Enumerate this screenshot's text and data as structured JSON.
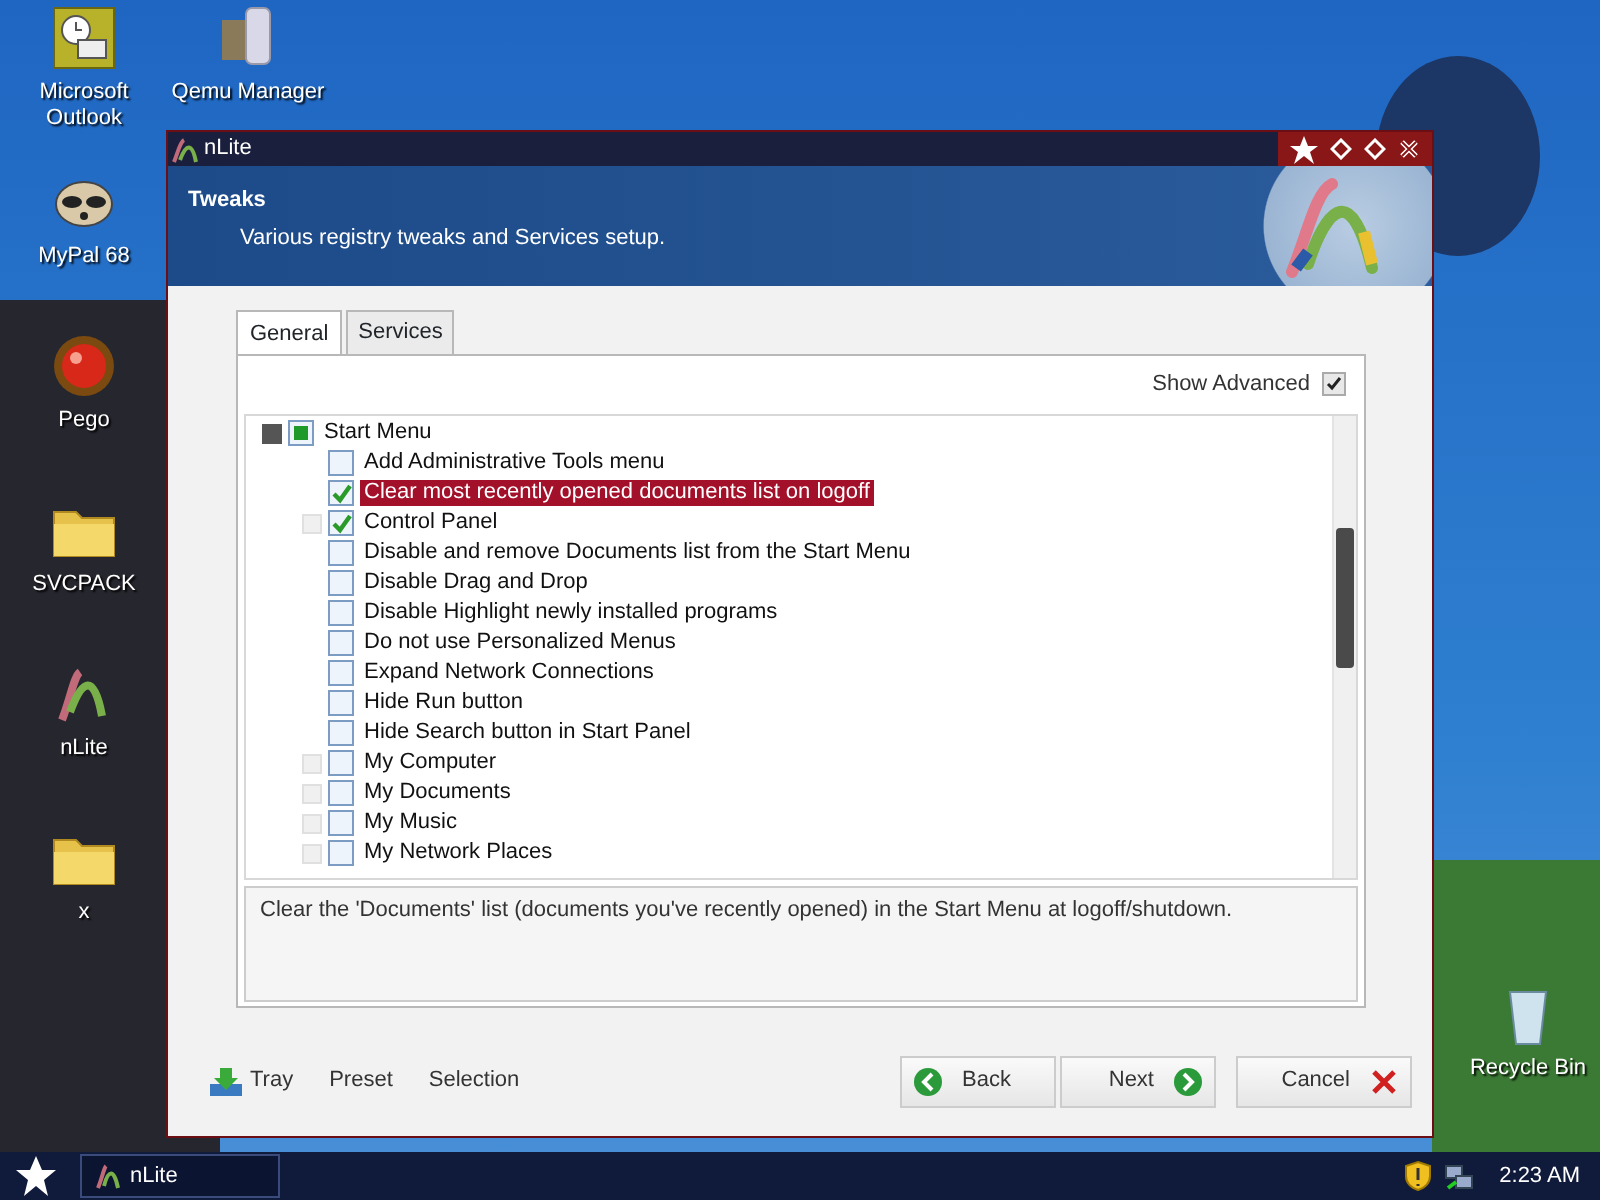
{
  "desktop": {
    "columns": [
      [
        {
          "label": "Microsoft Outlook",
          "kind": "outlook"
        },
        {
          "label": "MyPal 68",
          "kind": "raccoon"
        },
        {
          "label": "Pego",
          "kind": "orb"
        },
        {
          "label": "SVCPACK",
          "kind": "folder"
        },
        {
          "label": "nLite",
          "kind": "nlite"
        },
        {
          "label": "x",
          "kind": "folder"
        }
      ],
      [
        {
          "label": "Qemu Manager",
          "kind": "qemu"
        }
      ]
    ],
    "recycle_bin": {
      "label": "Recycle Bin"
    }
  },
  "window": {
    "title": "nLite",
    "header": {
      "title": "Tweaks",
      "subtitle": "Various registry tweaks and Services setup."
    },
    "tabs": [
      {
        "label": "General",
        "selected": true
      },
      {
        "label": "Services",
        "selected": false
      }
    ],
    "show_advanced": {
      "label": "Show Advanced",
      "checked": true
    },
    "tree": [
      {
        "label": "Start Menu",
        "checked": false,
        "partial": true,
        "expanded": true,
        "selected": false,
        "children": [
          {
            "label": "Add Administrative Tools menu",
            "checked": false,
            "partial": false,
            "selected": false
          },
          {
            "label": "Clear most recently opened documents list on logoff",
            "checked": true,
            "partial": false,
            "selected": true
          },
          {
            "label": "Control Panel",
            "checked": true,
            "partial": false,
            "expanded": false,
            "selected": false
          },
          {
            "label": "Disable and remove Documents list from the Start Menu",
            "checked": false,
            "partial": false,
            "selected": false
          },
          {
            "label": "Disable Drag and Drop",
            "checked": false,
            "partial": false,
            "selected": false
          },
          {
            "label": "Disable Highlight newly installed programs",
            "checked": false,
            "partial": false,
            "selected": false
          },
          {
            "label": "Do not use Personalized Menus",
            "checked": false,
            "partial": false,
            "selected": false
          },
          {
            "label": "Expand Network Connections",
            "checked": false,
            "partial": false,
            "selected": false
          },
          {
            "label": "Hide Run button",
            "checked": false,
            "partial": false,
            "selected": false
          },
          {
            "label": "Hide Search button in Start Panel",
            "checked": false,
            "partial": false,
            "selected": false
          },
          {
            "label": "My Computer",
            "checked": false,
            "partial": false,
            "expanded": false,
            "selected": false
          },
          {
            "label": "My Documents",
            "checked": false,
            "partial": false,
            "expanded": false,
            "selected": false
          },
          {
            "label": "My Music",
            "checked": false,
            "partial": false,
            "expanded": false,
            "selected": false
          },
          {
            "label": "My Network Places",
            "checked": false,
            "partial": false,
            "expanded": false,
            "selected": false
          }
        ]
      }
    ],
    "description": "Clear the 'Documents' list (documents you've recently opened) in the Start Menu at logoff/shutdown.",
    "footer_links": [
      {
        "label": "Tray",
        "kind": "tray"
      },
      {
        "label": "Preset",
        "kind": "plain"
      },
      {
        "label": "Selection",
        "kind": "plain"
      }
    ],
    "buttons": [
      {
        "label": "Back",
        "kind": "back"
      },
      {
        "label": "Next",
        "kind": "next"
      },
      {
        "label": "Cancel",
        "kind": "cancel"
      }
    ]
  },
  "taskbar": {
    "tasks": [
      {
        "label": "nLite",
        "selected": true
      }
    ],
    "clock": "2:23 AM"
  }
}
